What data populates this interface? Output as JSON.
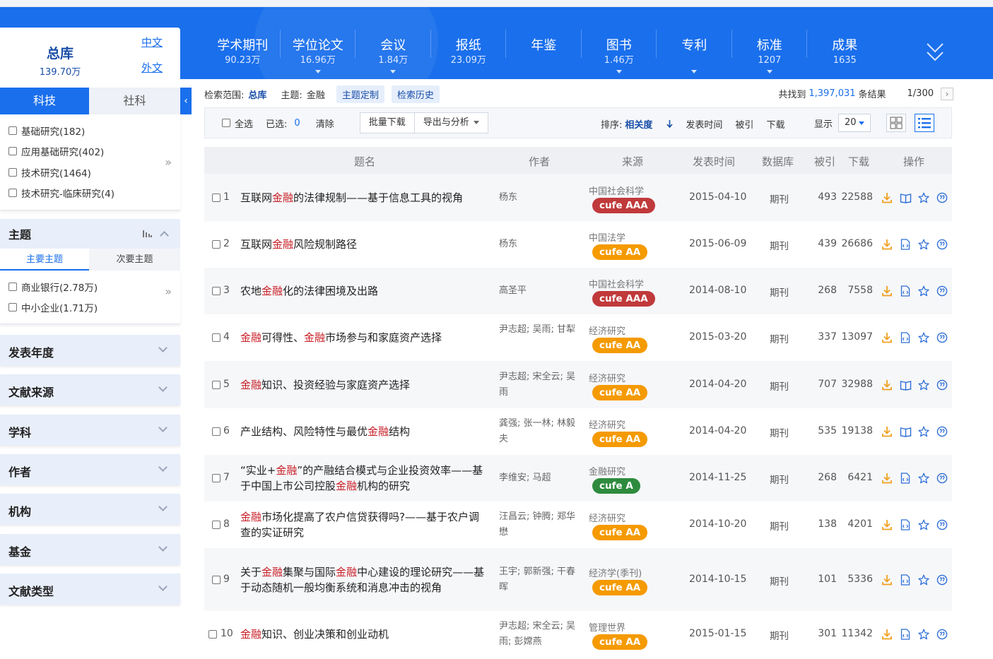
{
  "db_tabs": [
    {
      "name": "学术期刊",
      "count": "90.23万",
      "arrow": false
    },
    {
      "name": "学位论文",
      "count": "16.96万",
      "arrow": true
    },
    {
      "name": "会议",
      "count": "1.84万",
      "arrow": true
    },
    {
      "name": "报纸",
      "count": "23.09万",
      "arrow": false
    },
    {
      "name": "年鉴",
      "count": "",
      "arrow": false
    },
    {
      "name": "图书",
      "count": "1.46万",
      "arrow": true
    },
    {
      "name": "专利",
      "count": "",
      "arrow": true
    },
    {
      "name": "标准",
      "count": "1207",
      "arrow": true
    },
    {
      "name": "成果",
      "count": "1635",
      "arrow": false
    }
  ],
  "library": {
    "title": "总库",
    "count": "139.70万",
    "chinese": "中文",
    "foreign": "外文"
  },
  "sidebar": {
    "tab_sci": "科技",
    "tab_soc": "社科",
    "categories": [
      "基础研究(182)",
      "应用基础研究(402)",
      "技术研究(1464)",
      "技术研究-临床研究(4)"
    ],
    "more": "»",
    "topic_title": "主题",
    "topic_main": "主要主题",
    "topic_sub": "次要主题",
    "topics": [
      "商业银行(2.78万)",
      "中小企业(1.71万)"
    ],
    "facets": [
      "发表年度",
      "文献来源",
      "学科",
      "作者",
      "机构",
      "基金",
      "文献类型"
    ]
  },
  "crumbs": {
    "scope_label": "检索范围:",
    "scope_value": "总库",
    "topic_label": "主题:",
    "topic_value": "金融",
    "custom": "主题定制",
    "history": "检索历史",
    "found_prefix": "共找到",
    "found_count": "1,397,031",
    "found_suffix": "条结果",
    "page": "1/300",
    "next": "›"
  },
  "toolbar": {
    "select_all": "全选",
    "selected_label": "已选:",
    "selected_count": "0",
    "clear": "清除",
    "batch_download": "批量下载",
    "export": "导出与分析",
    "sort_label": "排序:",
    "sort_relevance": "相关度",
    "sort_time": "发表时间",
    "sort_cite": "被引",
    "sort_download": "下载",
    "display_label": "显示",
    "page_size": "20"
  },
  "columns": [
    "题名",
    "作者",
    "来源",
    "发表时间",
    "数据库",
    "被引",
    "下载",
    "操作"
  ],
  "rows": [
    {
      "idx": "1",
      "title": [
        [
          "互联网",
          0
        ],
        [
          "金融",
          1
        ],
        [
          "的法律规制——基于信息工具的视角",
          0
        ]
      ],
      "author": "杨东",
      "source": "中国社会科学",
      "badge": "cufe AAA",
      "badge_color": "#c0393b",
      "date": "2015-04-10",
      "db": "期刊",
      "cite": "493",
      "downloads": "22588",
      "read_icon": "book"
    },
    {
      "idx": "2",
      "title": [
        [
          "互联网",
          0
        ],
        [
          "金融",
          1
        ],
        [
          "风险规制路径",
          0
        ]
      ],
      "author": "杨东",
      "source": "中国法学",
      "badge": "cufe AA",
      "badge_color": "#f59a00",
      "date": "2015-06-09",
      "db": "期刊",
      "cite": "439",
      "downloads": "26686",
      "read_icon": "html"
    },
    {
      "idx": "3",
      "title": [
        [
          "农地",
          0
        ],
        [
          "金融",
          1
        ],
        [
          "化的法律困境及出路",
          0
        ]
      ],
      "author": "高圣平",
      "source": "中国社会科学",
      "badge": "cufe AAA",
      "badge_color": "#c0393b",
      "date": "2014-08-10",
      "db": "期刊",
      "cite": "268",
      "downloads": "7558",
      "read_icon": "html"
    },
    {
      "idx": "4",
      "title": [
        [
          "金融",
          1
        ],
        [
          "可得性、",
          0
        ],
        [
          "金融",
          1
        ],
        [
          "市场参与和家庭资产选择",
          0
        ]
      ],
      "author": "尹志超; 吴雨; 甘犁",
      "source": "经济研究",
      "badge": "cufe AA",
      "badge_color": "#f59a00",
      "date": "2015-03-20",
      "db": "期刊",
      "cite": "337",
      "downloads": "13097",
      "read_icon": "html"
    },
    {
      "idx": "5",
      "title": [
        [
          "金融",
          1
        ],
        [
          "知识、投资经验与家庭资产选择",
          0
        ]
      ],
      "author": "尹志超; 宋全云; 吴雨",
      "source": "经济研究",
      "badge": "cufe AA",
      "badge_color": "#f59a00",
      "date": "2014-04-20",
      "db": "期刊",
      "cite": "707",
      "downloads": "32988",
      "read_icon": "book"
    },
    {
      "idx": "6",
      "title": [
        [
          "产业结构、风险特性与最优",
          0
        ],
        [
          "金融",
          1
        ],
        [
          "结构",
          0
        ]
      ],
      "author": "龚强; 张一林; 林毅夫",
      "source": "经济研究",
      "badge": "cufe AA",
      "badge_color": "#f59a00",
      "date": "2014-04-20",
      "db": "期刊",
      "cite": "535",
      "downloads": "19138",
      "read_icon": "book"
    },
    {
      "idx": "7",
      "title": [
        [
          "“实业+",
          0
        ],
        [
          "金融",
          1
        ],
        [
          "”的产融结合模式与企业投资效率——基于中国上市公司控股",
          0
        ],
        [
          "金融",
          1
        ],
        [
          "机构的研究",
          0
        ]
      ],
      "author": "李维安; 马超",
      "source": "金融研究",
      "badge": "cufe A",
      "badge_color": "#2e8b3e",
      "date": "2014-11-25",
      "db": "期刊",
      "cite": "268",
      "downloads": "6421",
      "read_icon": "html"
    },
    {
      "idx": "8",
      "title": [
        [
          "金融",
          1
        ],
        [
          "市场化提高了农户信贷获得吗?——基于农户调查的实证研究",
          0
        ]
      ],
      "author": "汪昌云; 钟腾; 郑华懋",
      "source": "经济研究",
      "badge": "cufe AA",
      "badge_color": "#f59a00",
      "date": "2014-10-20",
      "db": "期刊",
      "cite": "138",
      "downloads": "4201",
      "read_icon": "html"
    },
    {
      "idx": "9",
      "title": [
        [
          "关于",
          0
        ],
        [
          "金融",
          1
        ],
        [
          "集聚与国际",
          0
        ],
        [
          "金融",
          1
        ],
        [
          "中心建设的理论研究——基于动态随机一般均衡系统和消息冲击的视角",
          0
        ]
      ],
      "author": "王宇; 郭新强; 干春晖",
      "source": "经济学(季刊)",
      "badge": "cufe AA",
      "badge_color": "#f59a00",
      "date": "2014-10-15",
      "db": "期刊",
      "cite": "101",
      "downloads": "5336",
      "read_icon": "html"
    },
    {
      "idx": "10",
      "title": [
        [
          "金融",
          1
        ],
        [
          "知识、创业决策和创业动机",
          0
        ]
      ],
      "author": "尹志超; 宋全云; 吴雨; 彭嫦燕",
      "source": "管理世界",
      "badge": "cufe AA",
      "badge_color": "#f59a00",
      "date": "2015-01-15",
      "db": "期刊",
      "cite": "301",
      "downloads": "11342",
      "read_icon": "html"
    }
  ],
  "colors": {
    "brand": "#1a6fec",
    "keyword": "#c81d25",
    "download_icon": "#f0a020",
    "op_icon": "#2f6fd6"
  }
}
